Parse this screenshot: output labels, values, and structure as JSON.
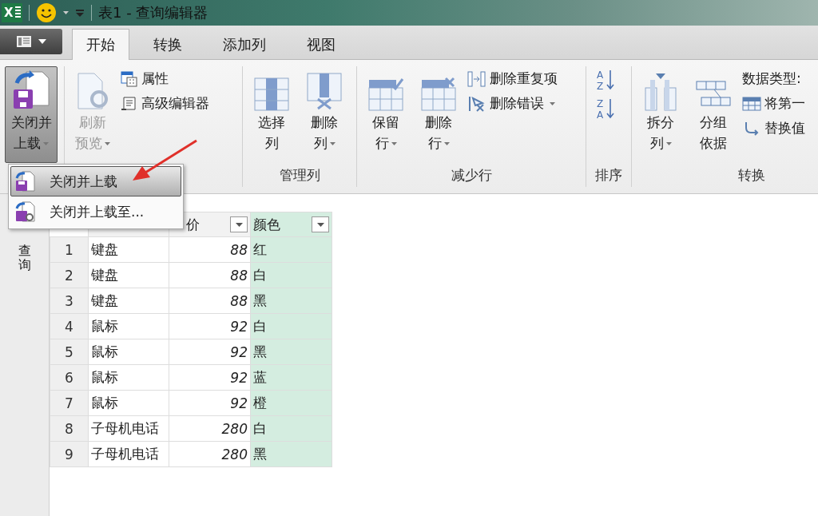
{
  "window": {
    "app_letter": "X",
    "title": "表1 - 查询编辑器"
  },
  "tabs": [
    {
      "label": "开始",
      "selected": true
    },
    {
      "label": "转换",
      "selected": false
    },
    {
      "label": "添加列",
      "selected": false
    },
    {
      "label": "视图",
      "selected": false
    }
  ],
  "ribbon": {
    "groups": [
      {
        "items": [
          {
            "kind": "large",
            "lines": [
              "关闭并",
              "上载"
            ],
            "dropdown": true,
            "disabled": false,
            "expanded": true
          }
        ]
      },
      {
        "items": [
          {
            "kind": "large",
            "lines": [
              "刷新",
              "预览"
            ],
            "dropdown": true,
            "disabled": true,
            "expanded": false
          },
          {
            "kind": "small",
            "label": "属性",
            "dropdown": false,
            "disabled": false
          },
          {
            "kind": "small",
            "label": "高级编辑器",
            "dropdown": false,
            "disabled": false
          }
        ]
      },
      {
        "label": "管理列",
        "items": [
          {
            "kind": "large",
            "lines": [
              "选择",
              "列"
            ],
            "dropdown": false,
            "disabled": false,
            "expanded": false
          },
          {
            "kind": "large",
            "lines": [
              "删除",
              "列"
            ],
            "dropdown": true,
            "disabled": false,
            "expanded": false
          }
        ]
      },
      {
        "label": "减少行",
        "items": [
          {
            "kind": "large",
            "lines": [
              "保留",
              "行"
            ],
            "dropdown": true,
            "disabled": false,
            "expanded": false
          },
          {
            "kind": "large",
            "lines": [
              "删除",
              "行"
            ],
            "dropdown": true,
            "disabled": false,
            "expanded": false
          },
          {
            "kind": "small",
            "label": "删除重复项",
            "dropdown": false,
            "disabled": false
          },
          {
            "kind": "small",
            "label": "删除错误",
            "dropdown": true,
            "disabled": false
          }
        ]
      },
      {
        "label": "排序",
        "items": [
          {
            "kind": "icon",
            "glyphs": [
              "A",
              "Z"
            ]
          },
          {
            "kind": "icon",
            "glyphs": [
              "Z",
              "A"
            ]
          }
        ]
      },
      {
        "label": "转换",
        "items": [
          {
            "kind": "large",
            "lines": [
              "拆分",
              "列"
            ],
            "dropdown": true,
            "disabled": false,
            "expanded": false
          },
          {
            "kind": "large",
            "lines": [
              "分组",
              "依据"
            ],
            "dropdown": false,
            "disabled": false,
            "expanded": false
          },
          {
            "kind": "small",
            "label": "数据类型: ",
            "dropdown": false,
            "disabled": false
          },
          {
            "kind": "small",
            "label": "将第一",
            "dropdown": false,
            "disabled": false
          },
          {
            "kind": "small",
            "label": "替换值",
            "dropdown": false,
            "disabled": false
          }
        ]
      }
    ]
  },
  "menu": {
    "items": [
      {
        "label": "关闭并上载",
        "selected": true
      },
      {
        "label": "关闭并上载至...",
        "selected": false
      }
    ]
  },
  "side_pane": {
    "label": "查询"
  },
  "table": {
    "columns": [
      {
        "kind": "text",
        "selected": false
      },
      {
        "label": "价",
        "kind": "number",
        "selected": false
      },
      {
        "label": "颜色",
        "kind": "text",
        "selected": true
      }
    ],
    "rows": [
      {
        "number": "1",
        "cells": [
          "键盘",
          "88",
          "红"
        ]
      },
      {
        "number": "2",
        "cells": [
          "键盘",
          "88",
          "白"
        ]
      },
      {
        "number": "3",
        "cells": [
          "键盘",
          "88",
          "黑"
        ]
      },
      {
        "number": "4",
        "cells": [
          "鼠标",
          "92",
          "白"
        ]
      },
      {
        "number": "5",
        "cells": [
          "鼠标",
          "92",
          "黑"
        ]
      },
      {
        "number": "6",
        "cells": [
          "鼠标",
          "92",
          "蓝"
        ]
      },
      {
        "number": "7",
        "cells": [
          "鼠标",
          "92",
          "橙"
        ]
      },
      {
        "number": "8",
        "cells": [
          "子母机电话",
          "280",
          "白"
        ]
      },
      {
        "number": "9",
        "cells": [
          "子母机电话",
          "280",
          "黑"
        ]
      }
    ]
  }
}
